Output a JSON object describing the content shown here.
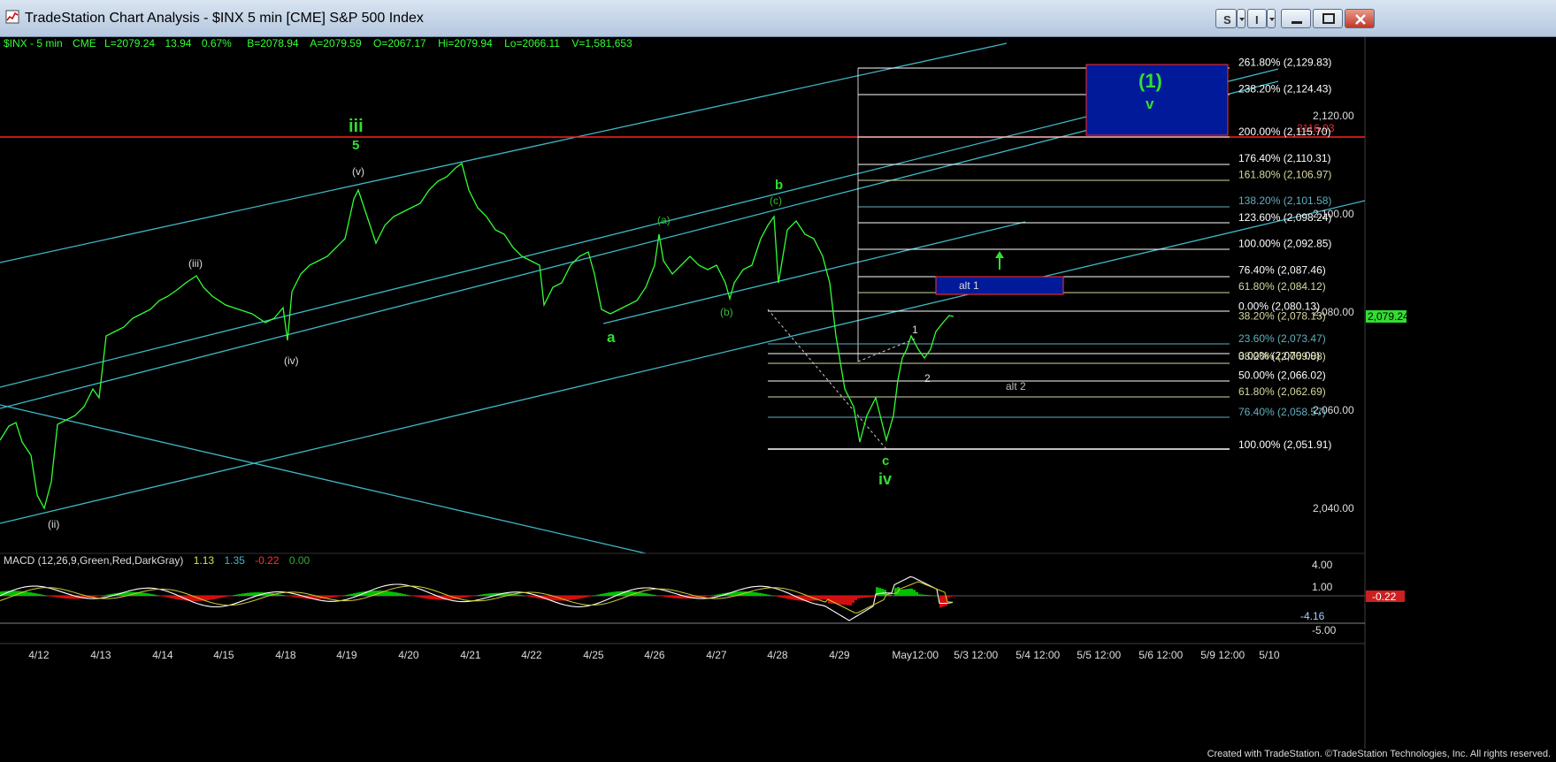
{
  "window": {
    "title": "TradeStation Chart Analysis - $INX 5 min [CME] S&P 500 Index",
    "buttons": {
      "s_label": "S",
      "i_label": "I"
    }
  },
  "header": {
    "symbol": "$INX - 5 min",
    "exchange": "CME",
    "last": "L=2079.24",
    "change": "13.94",
    "change_pct": "0.67%",
    "bid": "B=2078.94",
    "ask": "A=2079.59",
    "open": "O=2067.17",
    "high": "Hi=2079.94",
    "low": "Lo=2066.11",
    "volume": "V=1,581,653"
  },
  "price_axis": {
    "labels": [
      "2,120.00",
      "2,100.00",
      "2,080.00",
      "2,060.00",
      "2,040.00"
    ],
    "last_price": "2,079.24"
  },
  "fib_upper": [
    {
      "pct": "261.80%",
      "price": "(2,129.83)",
      "color": "#ffffff"
    },
    {
      "pct": "238.20%",
      "price": "(2,124.43)",
      "color": "#ffffff"
    },
    {
      "pct": "200.00%",
      "price": "(2,115.70)",
      "color": "#ffffff"
    },
    {
      "pct": "176.40%",
      "price": "(2,110.31)",
      "color": "#ffffff"
    },
    {
      "pct": "161.80%",
      "price": "(2,106.97)",
      "color": "#d8d8a0"
    },
    {
      "pct": "138.20%",
      "price": "(2,101.58)",
      "color": "#5fb0c0"
    },
    {
      "pct": "123.60%",
      "price": "(2,098.24)",
      "color": "#ffffff"
    },
    {
      "pct": "100.00%",
      "price": "(2,092.85)",
      "color": "#ffffff"
    },
    {
      "pct": "76.40%",
      "price": "(2,087.46)",
      "color": "#ffffff"
    },
    {
      "pct": "61.80%",
      "price": "(2,084.12)",
      "color": "#d8d8a0"
    },
    {
      "pct": "0.00%",
      "price": "(2,080.13)",
      "color": "#ffffff"
    }
  ],
  "fib_lower": [
    {
      "pct": "38.20%",
      "price": "(2,078.13)",
      "color": "#d8d8a0"
    },
    {
      "pct": "23.60%",
      "price": "(2,073.47)",
      "color": "#5fb0c0"
    },
    {
      "pct": "0.00%",
      "price": "(2,070.00)",
      "color": "#ffffff"
    },
    {
      "pct": "38.20%",
      "price": "(2,069.88)",
      "color": "#d8d8a0"
    },
    {
      "pct": "50.00%",
      "price": "(2,066.02)",
      "color": "#ffffff"
    },
    {
      "pct": "61.80%",
      "price": "(2,062.69)",
      "color": "#d8d8a0"
    },
    {
      "pct": "76.40%",
      "price": "(2,058.57)",
      "color": "#5fb0c0"
    },
    {
      "pct": "100.00%",
      "price": "(2,051.91)",
      "color": "#ffffff"
    }
  ],
  "red_line_label": "2116.03",
  "wave_labels": {
    "green_iii": "iii",
    "green_5": "5",
    "green_a": "a",
    "green_b": "b",
    "green_c": "c",
    "green_iv": "iv",
    "big_1": "(1)",
    "green_v": "v",
    "w_ii": "(ii)",
    "w_iii": "(iii)",
    "w_iv": "(iv)",
    "w_v": "(v)",
    "w_a": "(a)",
    "w_b": "(b)",
    "w_c": "(c)",
    "n1": "1",
    "n2": "2",
    "alt1": "alt 1",
    "alt2": "alt 2"
  },
  "macd": {
    "label": "MACD (12,26,9,Green,Red,DarkGray)",
    "v1": "1.13",
    "v2": "1.35",
    "v3": "-0.22",
    "v4": "0.00",
    "axis_labels": [
      "4.00",
      "1.00",
      "-5.00"
    ],
    "current": "-0.22",
    "min_label": "-4.16"
  },
  "time_axis": [
    "4/12",
    "4/13",
    "4/14",
    "4/15",
    "4/18",
    "4/19",
    "4/20",
    "4/21",
    "4/22",
    "4/25",
    "4/26",
    "4/27",
    "4/28",
    "4/29",
    "May12:00",
    "5/3 12:00",
    "5/4 12:00",
    "5/5 12:00",
    "5/6 12:00",
    "5/9 12:00",
    "5/10"
  ],
  "footer": {
    "credit": "Created with TradeStation. ©TradeStation Technologies, Inc. All rights reserved."
  },
  "colors": {
    "price": "#33ff33",
    "channel": "#3fb8c8",
    "red_line": "#ff2020",
    "box": "#001a99",
    "macd_line": "#ffffff",
    "signal": "#cccc33"
  }
}
